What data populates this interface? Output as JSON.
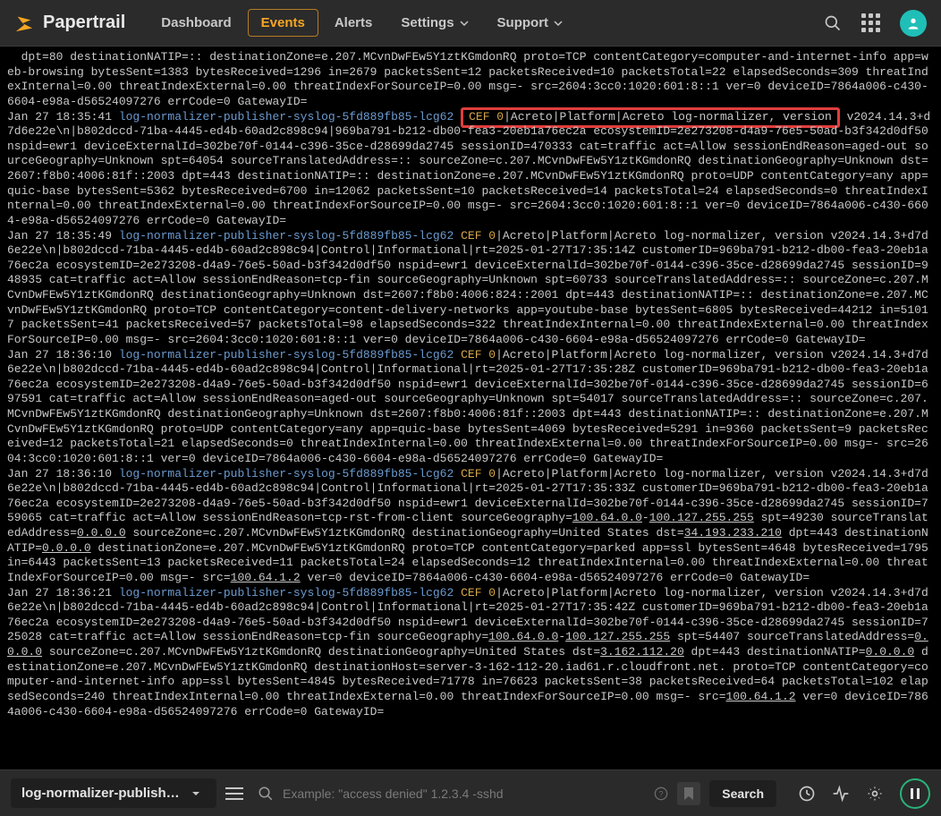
{
  "header": {
    "brand": "Papertrail",
    "nav": {
      "dashboard": "Dashboard",
      "events": "Events",
      "alerts": "Alerts",
      "settings": "Settings",
      "support": "Support"
    }
  },
  "logs": {
    "pre0": "  dpt=80 destinationNATIP=:: destinationZone=e.207.MCvnDwFEw5Y1ztKGmdonRQ proto=TCP contentCategory=computer-and-internet-info app=web-browsing bytesSent=1383 bytesReceived=1296 in=2679 packetsSent=12 packetsReceived=10 packetsTotal=22 elapsedSeconds=309 threatIndexInternal=0.00 threatIndexExternal=0.00 threatIndexForSourceIP=0.00 msg=- src=2604:3cc0:1020:601:8::1 ver=0 deviceID=7864a006-c430-6604-e98a-d56524097276 errCode=0 GatewayID=",
    "entries": [
      {
        "ts": "Jan 27 18:35:41",
        "host": "log-normalizer-publisher-syslog-5fd889fb85-lcg62",
        "cef": "CEF 0",
        "hlbox": true,
        "hl_text": "CEF 0|Acreto|Platform|Acreto log-normalizer, version",
        "tail_v": "v2024.14.3+d7d6e22e\\n|b802dccd-71ba-4445-ed4b-60ad2c898c94|",
        "tail_after_mask": "969ba791-b212-db00-fea3-20eb1a76ec2a ecosystemID=2e273208-d4a9-76e5-50ad-b3f342d0df50 nspid=ewr1 deviceExternalId=302be70f-0144-c396-35ce-d28699da2745 sessionID=470333 cat=traffic act=Allow sessionEndReason=aged-out sourceGeography=Unknown spt=64054 sourceTranslatedAddress=:: sourceZone=c.207.MCvnDwFEw5Y1ztKGmdonRQ destinationGeography=Unknown dst=2607:f8b0:4006:81f::2003 dpt=443 destinationNATIP=:: destinationZone=e.207.MCvnDwFEw5Y1ztKGmdonRQ proto=UDP contentCategory=any app=quic-base bytesSent=5362 bytesReceived=6700 in=12062 packetsSent=10 packetsReceived=14 packetsTotal=24 elapsedSeconds=0 threatIndexInternal=0.00 threatIndexExternal=0.00 threatIndexForSourceIP=0.00 msg=- src=2604:3cc0:1020:601:8::1 ver=0 deviceID=7864a006-c430-6604-e98a-d56524097276 errCode=0 GatewayID="
      },
      {
        "ts": "Jan 27 18:35:49",
        "host": "log-normalizer-publisher-syslog-5fd889fb85-lcg62",
        "cef": "CEF 0",
        "tail": "|Acreto|Platform|Acreto log-normalizer, version v2024.14.3+d7d6e22e\\n|b802dccd-71ba-4445-ed4b-60ad2c898c94|Control|Informational|rt=2025-01-27T17:35:14Z customerID=969ba791-b212-db00-fea3-20eb1a76ec2a ecosystemID=2e273208-d4a9-76e5-50ad-b3f342d0df50 nspid=ewr1 deviceExternalId=302be70f-0144-c396-35ce-d28699da2745 sessionID=948935 cat=traffic act=Allow sessionEndReason=tcp-fin sourceGeography=Unknown spt=60733 sourceTranslatedAddress=:: sourceZone=c.207.MCvnDwFEw5Y1ztKGmdonRQ destinationGeography=Unknown dst=2607:f8b0:4006:824::2001 dpt=443 destinationNATIP=:: destinationZone=e.207.MCvnDwFEw5Y1ztKGmdonRQ proto=TCP contentCategory=content-delivery-networks app=youtube-base bytesSent=6805 bytesReceived=44212 in=51017 packetsSent=41 packetsReceived=57 packetsTotal=98 elapsedSeconds=322 threatIndexInternal=0.00 threatIndexExternal=0.00 threatIndexForSourceIP=0.00 msg=- src=2604:3cc0:1020:601:8::1 ver=0 deviceID=7864a006-c430-6604-e98a-d56524097276 errCode=0 GatewayID="
      },
      {
        "ts": "Jan 27 18:36:10",
        "host": "log-normalizer-publisher-syslog-5fd889fb85-lcg62",
        "cef": "CEF 0",
        "tail": "|Acreto|Platform|Acreto log-normalizer, version v2024.14.3+d7d6e22e\\n|b802dccd-71ba-4445-ed4b-60ad2c898c94|Control|Informational|rt=2025-01-27T17:35:28Z customerID=969ba791-b212-db00-fea3-20eb1a76ec2a ecosystemID=2e273208-d4a9-76e5-50ad-b3f342d0df50 nspid=ewr1 deviceExternalId=302be70f-0144-c396-35ce-d28699da2745 sessionID=697591 cat=traffic act=Allow sessionEndReason=aged-out sourceGeography=Unknown spt=54017 sourceTranslatedAddress=:: sourceZone=c.207.MCvnDwFEw5Y1ztKGmdonRQ destinationGeography=Unknown dst=2607:f8b0:4006:81f::2003 dpt=443 destinationNATIP=:: destinationZone=e.207.MCvnDwFEw5Y1ztKGmdonRQ proto=UDP contentCategory=any app=quic-base bytesSent=4069 bytesReceived=5291 in=9360 packetsSent=9 packetsReceived=12 packetsTotal=21 elapsedSeconds=0 threatIndexInternal=0.00 threatIndexExternal=0.00 threatIndexForSourceIP=0.00 msg=- src=2604:3cc0:1020:601:8::1 ver=0 deviceID=7864a006-c430-6604-e98a-d56524097276 errCode=0 GatewayID="
      },
      {
        "ts": "Jan 27 18:36:10",
        "host": "log-normalizer-publisher-syslog-5fd889fb85-lcg62",
        "cef": "CEF 0",
        "parts": [
          {
            "t": "|Acreto|Platform|Acreto log-normalizer, version v2024.14.3+d7d6e22e\\n|b802dccd-71ba-4445-ed4b-60ad2c898c94|Control|Informational|rt=2025-01-27T17:35:33Z customerID=969ba791-b212-db00-fea3-20eb1a76ec2a ecosystemID=2e273208-d4a9-76e5-50ad-b3f342d0df50 nspid=ewr1 deviceExternalId=302be70f-0144-c396-35ce-d28699da2745 sessionID=759065 cat=traffic act=Allow sessionEndReason=tcp-rst-from-client sourceGeography="
          },
          {
            "t": "100.64.0.0",
            "u": true
          },
          {
            "t": "-"
          },
          {
            "t": "100.127.255.255",
            "u": true
          },
          {
            "t": " spt=49230 sourceTranslatedAddress="
          },
          {
            "t": "0.0.0.0",
            "u": true
          },
          {
            "t": " sourceZone=c.207.MCvnDwFEw5Y1ztKGmdonRQ destinationGeography=United States dst="
          },
          {
            "t": "34.193.233.210",
            "u": true
          },
          {
            "t": " dpt=443 destinationNATIP="
          },
          {
            "t": "0.0.0.0",
            "u": true
          },
          {
            "t": " destinationZone=e.207.MCvnDwFEw5Y1ztKGmdonRQ proto=TCP contentCategory=parked app=ssl bytesSent=4648 bytesReceived=1795 in=6443 packetsSent=13 packetsReceived=11 packetsTotal=24 elapsedSeconds=12 threatIndexInternal=0.00 threatIndexExternal=0.00 threatIndexForSourceIP=0.00 msg=- src="
          },
          {
            "t": "100.64.1.2",
            "u": true
          },
          {
            "t": " ver=0 deviceID=7864a006-c430-6604-e98a-d56524097276 errCode=0 GatewayID="
          }
        ]
      },
      {
        "ts": "Jan 27 18:36:21",
        "host": "log-normalizer-publisher-syslog-5fd889fb85-lcg62",
        "cef": "CEF 0",
        "parts": [
          {
            "t": "|Acreto|Platform|Acreto log-normalizer, version v2024.14.3+d7d6e22e\\n|b802dccd-71ba-4445-ed4b-60ad2c898c94|Control|Informational|rt=2025-01-27T17:35:42Z customerID=969ba791-b212-db00-fea3-20eb1a76ec2a ecosystemID=2e273208-d4a9-76e5-50ad-b3f342d0df50 nspid=ewr1 deviceExternalId=302be70f-0144-c396-35ce-d28699da2745 sessionID=725028 cat=traffic act=Allow sessionEndReason=tcp-fin sourceGeography="
          },
          {
            "t": "100.64.0.0",
            "u": true
          },
          {
            "t": "-"
          },
          {
            "t": "100.127.255.255",
            "u": true
          },
          {
            "t": " spt=54407 sourceTranslatedAddress="
          },
          {
            "t": "0.0.0.0",
            "u": true
          },
          {
            "t": " sourceZone=c.207.MCvnDwFEw5Y1ztKGmdonRQ destinationGeography=United States dst="
          },
          {
            "t": "3.162.112.20",
            "u": true
          },
          {
            "t": " dpt=443 destinationNATIP="
          },
          {
            "t": "0.0.0.0",
            "u": true
          },
          {
            "t": " destinationZone=e.207.MCvnDwFEw5Y1ztKGmdonRQ destinationHost=server-3-162-112-20.iad61.r.cloudfront.net. proto=TCP contentCategory=computer-and-internet-info app=ssl bytesSent=4845 bytesReceived=71778 in=76623 packetsSent=38 packetsReceived=64 packetsTotal=102 elapsedSeconds=240 threatIndexInternal=0.00 threatIndexExternal=0.00 threatIndexForSourceIP=0.00 msg=- src="
          },
          {
            "t": "100.64.1.2",
            "u": true
          },
          {
            "t": " ver=0 deviceID=7864a006-c430-6604-e98a-d56524097276 errCode=0 GatewayID="
          }
        ]
      }
    ]
  },
  "footer": {
    "source": "log-normalizer-publisher-sy...",
    "search_placeholder": "Example: \"access denied\" 1.2.3.4 -sshd",
    "search_button": "Search"
  }
}
